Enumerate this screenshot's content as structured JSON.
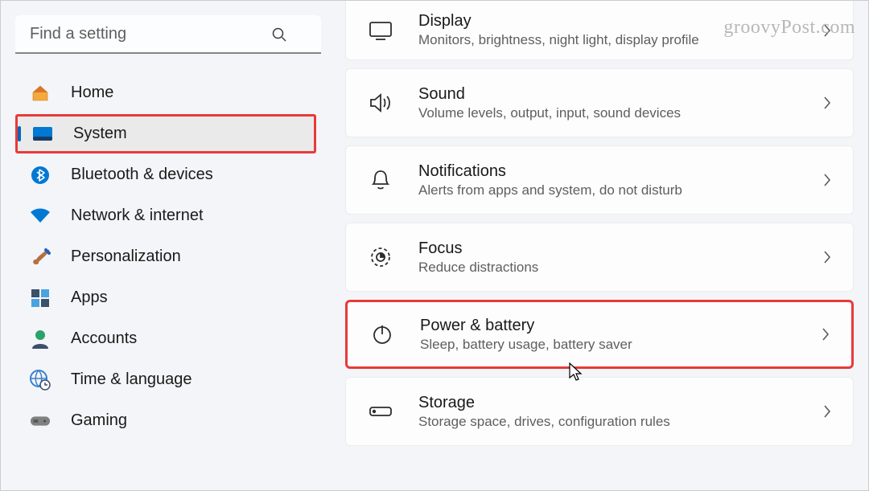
{
  "search": {
    "placeholder": "Find a setting"
  },
  "sidebar": {
    "items": [
      {
        "label": "Home"
      },
      {
        "label": "System"
      },
      {
        "label": "Bluetooth & devices"
      },
      {
        "label": "Network & internet"
      },
      {
        "label": "Personalization"
      },
      {
        "label": "Apps"
      },
      {
        "label": "Accounts"
      },
      {
        "label": "Time & language"
      },
      {
        "label": "Gaming"
      }
    ]
  },
  "main": {
    "items": [
      {
        "title": "Display",
        "sub": "Monitors, brightness, night light, display profile"
      },
      {
        "title": "Sound",
        "sub": "Volume levels, output, input, sound devices"
      },
      {
        "title": "Notifications",
        "sub": "Alerts from apps and system, do not disturb"
      },
      {
        "title": "Focus",
        "sub": "Reduce distractions"
      },
      {
        "title": "Power & battery",
        "sub": "Sleep, battery usage, battery saver"
      },
      {
        "title": "Storage",
        "sub": "Storage space, drives, configuration rules"
      }
    ]
  },
  "watermark": "groovyPost.com"
}
